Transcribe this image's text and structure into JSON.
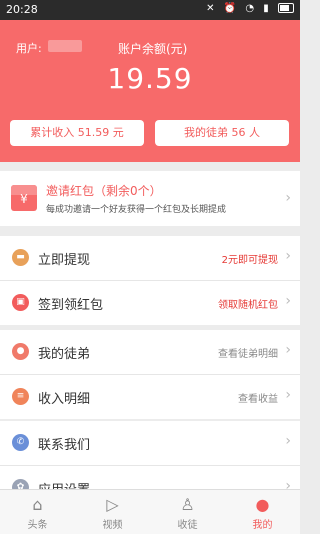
{
  "status_bar": {
    "time": "20:28"
  },
  "header": {
    "user_label": "用户:",
    "balance_label": "账户余额(元)",
    "balance": "19.59",
    "cumulative_button": "累计收入 51.59 元",
    "apprentice_button": "我的徒弟 56 人"
  },
  "invite": {
    "icon_char": "¥",
    "title": "邀请红包（剩余0个）",
    "subtitle": "每成功邀请一个好友获得一个红包及长期提成"
  },
  "group1": [
    {
      "label": "立即提现",
      "value": "2元即可提现",
      "icon": "wallet-icon",
      "color": "#e8a15a",
      "glyph": "▬"
    },
    {
      "label": "签到领红包",
      "value": "领取随机红包",
      "icon": "gift-icon",
      "color": "#f25c5c",
      "glyph": "▣"
    }
  ],
  "group2": [
    {
      "label": "我的徒弟",
      "value": "查看徒弟明细",
      "icon": "person-icon",
      "color": "#f07a6a",
      "glyph": "●"
    },
    {
      "label": "收入明细",
      "value": "查看收益",
      "icon": "list-icon",
      "color": "#f0845a",
      "glyph": "≡"
    }
  ],
  "group3": [
    {
      "label": "联系我们",
      "value": "",
      "icon": "phone-icon",
      "color": "#6a8fd8",
      "glyph": "✆"
    },
    {
      "label": "应用设置",
      "value": "",
      "icon": "gear-icon",
      "color": "#9aa3b5",
      "glyph": "✿"
    }
  ],
  "tabs": [
    {
      "label": "头条",
      "icon": "home-icon",
      "glyph": "⌂",
      "active": false
    },
    {
      "label": "视频",
      "icon": "play-icon",
      "glyph": "▷",
      "active": false
    },
    {
      "label": "收徒",
      "icon": "add-person-icon",
      "glyph": "♙",
      "active": false
    },
    {
      "label": "我的",
      "icon": "profile-icon",
      "glyph": "●",
      "active": true
    }
  ],
  "colors": {
    "accent": "#f76a6a",
    "accent_text": "#f25c5c"
  }
}
